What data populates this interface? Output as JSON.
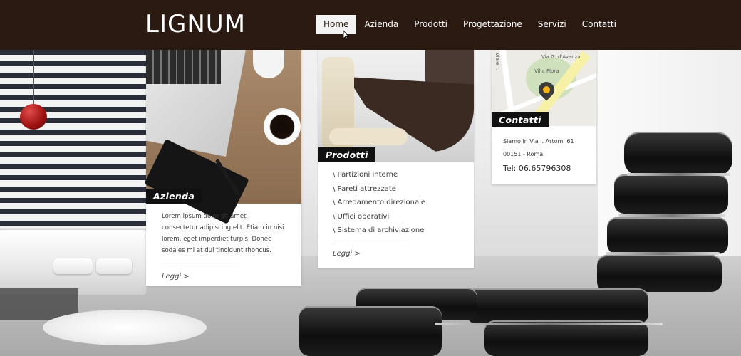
{
  "brand": {
    "logo": "LIGNUM"
  },
  "nav": {
    "items": [
      "Home",
      "Azienda",
      "Prodotti",
      "Progettazione",
      "Servizi",
      "Contatti"
    ],
    "active": "Home"
  },
  "cards": {
    "azienda": {
      "label": "Azienda",
      "text": "Lorem ipsum dolor sit amet, consectetur adipiscing elit. Etiam in nisi lorem, eget imperdiet turpis. Donec sodales mi at dui tincidunt rhoncus.",
      "more": "Leggi >"
    },
    "prodotti": {
      "label": "Prodotti",
      "items": [
        "\\ Partizioni interne",
        "\\ Pareti attrezzate",
        "\\ Arredamento direzionale",
        "\\ Uffici operativi",
        "\\ Sistema di archiviazione"
      ],
      "more": "Leggi >"
    },
    "contatti": {
      "label": "Contatti",
      "address_line1": "Siamo in Via I. Artom, 61",
      "address_line2": "00151 - Roma",
      "phone": "Tel: 06.65796308",
      "map_labels": [
        "Via G. d'Avanza",
        "Villa Flora",
        "Viale T."
      ]
    }
  },
  "colors": {
    "header_bg": "#2b1a12",
    "label_bg": "#111111",
    "active_nav_bg": "#f3f3f3"
  },
  "icons": {
    "cursor": "mouse-cursor-icon",
    "map_pin": "map-pin-icon"
  }
}
